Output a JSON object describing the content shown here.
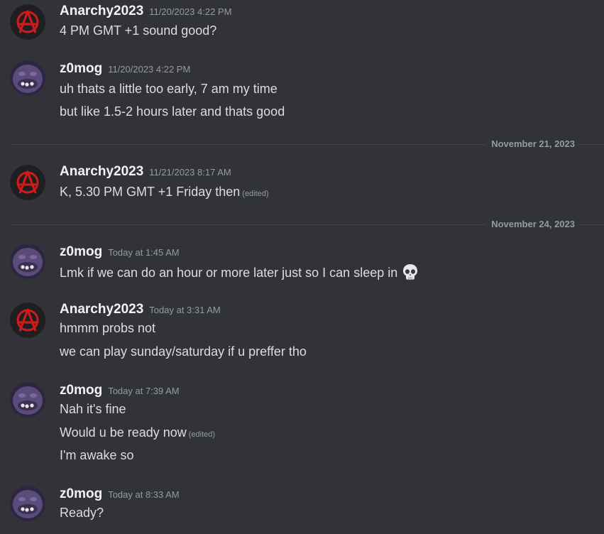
{
  "messages": [
    {
      "username": "Anarchy2023",
      "avatar": "anarchy-avatar",
      "timestamp": "11/20/2023 4:22 PM",
      "lines": [
        {
          "text": "4 PM GMT +1 sound good?"
        }
      ]
    },
    {
      "username": "z0mog",
      "avatar": "zomog-avatar",
      "timestamp": "11/20/2023 4:22 PM",
      "lines": [
        {
          "text": "uh thats a little too early, 7 am my time"
        },
        {
          "text": "but like 1.5-2 hours later and thats good"
        }
      ]
    },
    {
      "username": "Anarchy2023",
      "avatar": "anarchy-avatar",
      "timestamp": "11/21/2023 8:17 AM",
      "lines": [
        {
          "text": "K, 5.30 PM GMT +1 Friday then",
          "edited": "(edited)"
        }
      ]
    },
    {
      "username": "z0mog",
      "avatar": "zomog-avatar",
      "timestamp": "Today at 1:45 AM",
      "lines": [
        {
          "text": "Lmk if we can do an hour or more later just so I can sleep in",
          "emoji": "skull-emoji"
        }
      ]
    },
    {
      "username": "Anarchy2023",
      "avatar": "anarchy-avatar",
      "timestamp": "Today at 3:31 AM",
      "lines": [
        {
          "text": "hmmm probs not"
        },
        {
          "text": "we can play sunday/saturday if u preffer tho"
        }
      ]
    },
    {
      "username": "z0mog",
      "avatar": "zomog-avatar",
      "timestamp": "Today at 7:39 AM",
      "lines": [
        {
          "text": "Nah it's fine"
        },
        {
          "text": "Would u be ready now",
          "edited": "(edited)"
        },
        {
          "text": "I'm awake so"
        }
      ]
    },
    {
      "username": "z0mog",
      "avatar": "zomog-avatar",
      "timestamp": "Today at 8:33 AM",
      "lines": [
        {
          "text": "Ready?"
        }
      ]
    }
  ],
  "dividers": [
    "November 21, 2023",
    "November 24, 2023"
  ],
  "colors": {
    "background": "#313338",
    "username": "#f2f3f5",
    "text": "#dbdee1",
    "muted": "#949ba4",
    "anarchy_red": "#d11a1a"
  }
}
